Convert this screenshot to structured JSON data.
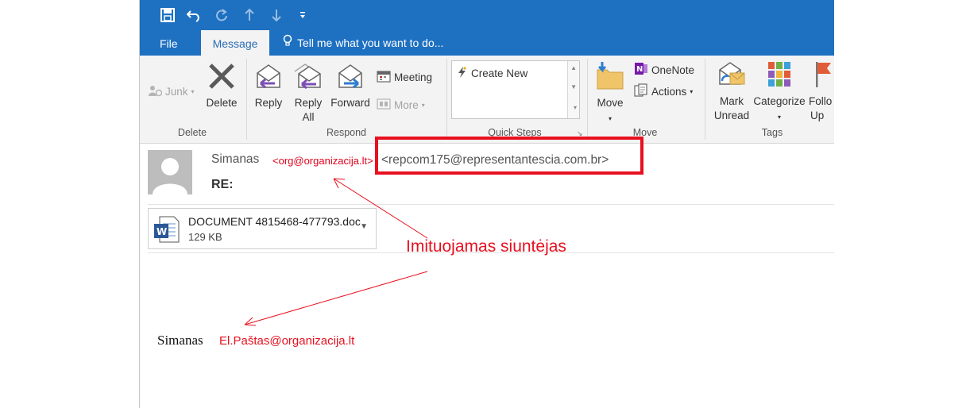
{
  "ribbon_tabs": {
    "file": "File",
    "message": "Message",
    "tell_me": "Tell me what you want to do..."
  },
  "groups": {
    "delete": {
      "label": "Delete",
      "junk": "Junk",
      "delete": "Delete"
    },
    "respond": {
      "label": "Respond",
      "reply": "Reply",
      "reply_all_1": "Reply",
      "reply_all_2": "All",
      "forward": "Forward",
      "meeting": "Meeting",
      "more": "More"
    },
    "quick_steps": {
      "label": "Quick Steps",
      "create_new": "Create New"
    },
    "move": {
      "label": "Move",
      "move": "Move",
      "onenote": "OneNote",
      "actions": "Actions"
    },
    "tags": {
      "label": "Tags",
      "mark_unread_1": "Mark",
      "mark_unread_2": "Unread",
      "categorize": "Categorize",
      "follow_up_1": "Follo",
      "follow_up_2": "Up"
    }
  },
  "message": {
    "sender_name": "Simanas",
    "sender_display_addr": "<org@organizacija.lt>",
    "sender_real_addr": "<repcom175@representantescia.com.br>",
    "subject": "RE:"
  },
  "attachment": {
    "name": "DOCUMENT 4815468-477793.doc",
    "size": "129 KB"
  },
  "annotation": "Imituojamas siuntėjas",
  "signature": {
    "name": "Simanas",
    "email": "El.Paštas@organizacija.lt"
  },
  "colors": {
    "title_blue": "#1e70c1",
    "ribbon_bg": "#f3f3f3",
    "annotation_red": "#e8101f"
  },
  "icons": [
    "save-icon",
    "undo-icon",
    "redo-icon",
    "up-icon",
    "down-icon",
    "customize-icon",
    "lightbulb-icon",
    "junk-icon",
    "delete-icon",
    "reply-icon",
    "reply-all-icon",
    "forward-icon",
    "meeting-icon",
    "more-icon",
    "lightning-icon",
    "move-icon",
    "onenote-icon",
    "actions-icon",
    "mark-unread-icon",
    "categorize-icon",
    "flag-icon",
    "avatar-icon",
    "word-doc-icon"
  ]
}
